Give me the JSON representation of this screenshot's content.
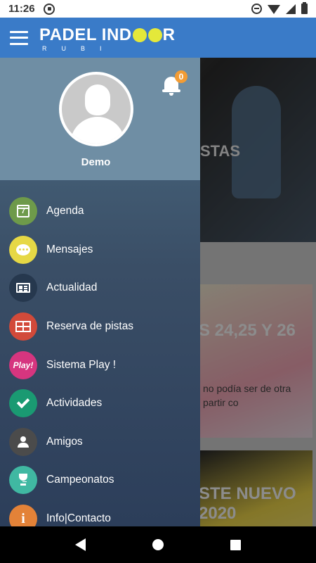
{
  "status_bar": {
    "time": "11:26"
  },
  "header": {
    "logo_main_left": "PADEL IND",
    "logo_main_right": "R",
    "logo_sub": "RUBI"
  },
  "background": {
    "hero_text": "STAS",
    "card1_title": "S 24,25 Y 26",
    "card1_snippet_line1": "no podía ser de otra",
    "card1_snippet_line2": "partir co",
    "card2_title_line1": "STE NUEVO",
    "card2_title_line2": "2020"
  },
  "drawer": {
    "user_name": "Demo",
    "notification_count": "0",
    "items": [
      {
        "label": "Agenda",
        "icon": "calendar-icon",
        "icon_text": "7",
        "color": "#6e9a4a"
      },
      {
        "label": "Mensajes",
        "icon": "chat-bubble-icon",
        "color": "#e6d845"
      },
      {
        "label": "Actualidad",
        "icon": "newspaper-icon",
        "color": "#26384e"
      },
      {
        "label": "Reserva de pistas",
        "icon": "court-icon",
        "color": "#d24a3a"
      },
      {
        "label": "Sistema Play !",
        "icon": "play-logo-icon",
        "icon_text": "Play!",
        "color": "#d6357f"
      },
      {
        "label": "Actividades",
        "icon": "checkmark-icon",
        "color": "#1a9a72"
      },
      {
        "label": "Amigos",
        "icon": "friends-icon",
        "color": "#4b4b4b"
      },
      {
        "label": "Campeonatos",
        "icon": "trophy-icon",
        "color": "#40b8a2"
      },
      {
        "label": "Info|Contacto",
        "icon": "info-icon",
        "icon_text": "i",
        "color": "#e38238"
      }
    ]
  },
  "colors": {
    "header": "#3a7bc8",
    "badge": "#f39c34",
    "drawer_head": "#6f8ea4"
  }
}
